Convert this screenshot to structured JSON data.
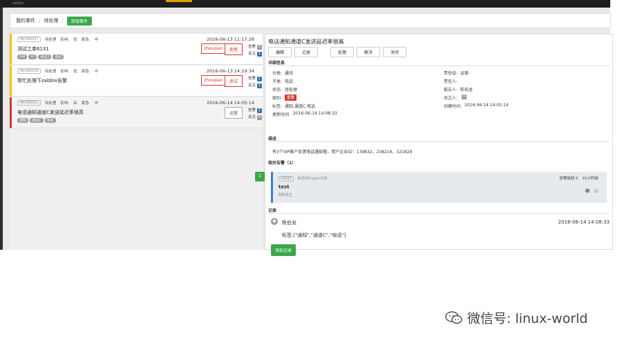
{
  "topbar": {
    "brand": "zabbix",
    "accent_color": "#e0a100"
  },
  "breadcrumb": {
    "my_events": "我的事件",
    "pending": "待处理",
    "add_event": "添加事件"
  },
  "cards": [
    {
      "id": "INC000017",
      "status": "待处理",
      "impact_label": "影响:",
      "impact": "低",
      "urgency_label": "紧急:",
      "urgency": "中",
      "time": "2016-06-13 11:17:28",
      "title": "测试工单6131",
      "tags": [
        "tag",
        "xx",
        "测试2",
        "测试"
      ],
      "assignee": "zhouqian",
      "action": "拒绝",
      "alarms_label": "告警",
      "alarms": "0",
      "follows_label": "关注",
      "follows": "1"
    },
    {
      "id": "INC000018",
      "status": "待处理",
      "impact_label": "影响:",
      "impact": "低",
      "urgency_label": "紧急:",
      "urgency": "中",
      "time": "2016-06-13 14:19:34",
      "title": "帮忙处理下zabbix告警",
      "tags": [],
      "assignee": "zhouqian",
      "action": "测试",
      "alarms_label": "告警",
      "alarms": "1",
      "follows_label": "关注",
      "follows": "1"
    },
    {
      "id": "INC000021",
      "status": "待处理",
      "impact_label": "影响:",
      "impact": "高",
      "urgency_label": "紧急:",
      "urgency": "中",
      "time": "2016-06-14 14:05:14",
      "title": "电话通知通道C发送延迟率很高",
      "tags": [
        "通知",
        "通道C",
        "电话"
      ],
      "assignee": "",
      "action": "运营",
      "alarms_label": "告警",
      "alarms": "1",
      "follows_label": "关注",
      "follows": "0"
    }
  ],
  "pager": {
    "page": "1"
  },
  "detail": {
    "title": "电话通知通道C发送延迟率很高",
    "toolbar": {
      "edit": "编辑",
      "record": "记录",
      "handle": "处理",
      "resolve": "解决",
      "close": "关闭"
    },
    "info_heading": "详细信息",
    "fields": {
      "category_k": "分类:",
      "category_v": "通讯",
      "subcategory_k": "子类:",
      "subcategory_v": "电话",
      "status_k": "状态:",
      "status_v": "待处理",
      "level_k": "级别:",
      "level_v": "重要",
      "tags_k": "标签:",
      "tags_v": "通知,通道C,电话",
      "updated_k": "更新时间:",
      "updated_v": "2016-06-14 14:08:33",
      "group_k": "责任组:",
      "group_v": "运营",
      "owner_k": "责任人:",
      "owner_v": "",
      "reporter_k": "报告人:",
      "reporter_v": "陈伯龙",
      "watcher_k": "关注人:",
      "watcher_v": "0",
      "created_k": "创建时间:",
      "created_v": "2016-06-14 14:05:14"
    },
    "desc_heading": "描述",
    "description": "有3个VIP客户反馈电话通知慢，用户企业ID：139832，238216，321829",
    "alerts_heading": "相关告警（1）",
    "alert": {
      "id": "10597",
      "source": "来源自Dragon应用",
      "name": "test",
      "sub": "刚刚发生",
      "level": "告警级别 0",
      "ago": "21小时前"
    },
    "log_heading": "记录",
    "log": {
      "author": "陈伯龙",
      "time": "2016-06-14 14:08:33",
      "text": "标签:[\"通知\",\"通道C\",\"电话\"]"
    },
    "add_log": "添加记录"
  },
  "watermark": {
    "text": "微信号: linux-world"
  }
}
